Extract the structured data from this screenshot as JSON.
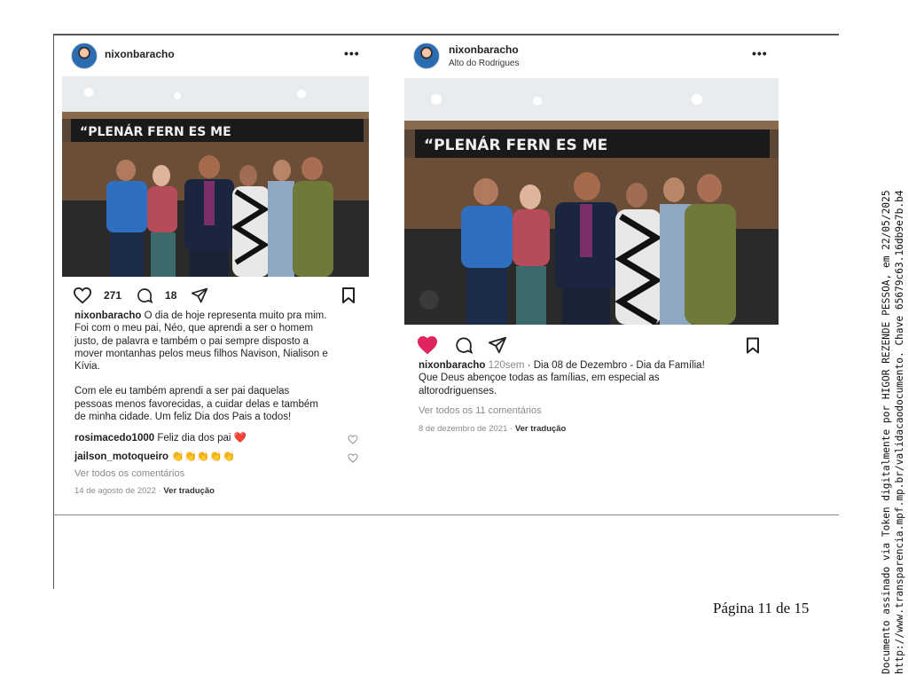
{
  "posts": [
    {
      "username": "nixonbaracho",
      "location": "",
      "more": "•••",
      "likes": "271",
      "comments_count": "18",
      "caption_user": "nixonbaracho",
      "caption_lines": [
        " O dia de hoje representa muito pra mim.",
        "Foi com o meu pai, Néo, que aprendi a ser o homem",
        "justo, de palavra e também o pai sempre disposto a",
        "mover montanhas pelos meus filhos Navison, Nialison e",
        "Kívia.",
        "",
        "Com ele eu também aprendi a ser pai daquelas",
        "pessoas menos favorecidas, a cuidar delas e também",
        "de minha cidade. Um feliz Dia dos Pais a todos!"
      ],
      "comments": [
        {
          "user": "rosimacedo1000",
          "text": " Feliz dia dos pai ❤️"
        },
        {
          "user": "jailson_motoqueiro",
          "text": " 👏👏👏👏👏"
        }
      ],
      "view_all": "Ver todos os comentários",
      "date": "14 de agosto de 2022",
      "translate": "Ver tradução",
      "photo_banner": "“PLENÁRIO ... FERNANDES ... MELO”",
      "liked": false
    },
    {
      "username": "nixonbaracho",
      "location": "Alto do Rodrigues",
      "more": "•••",
      "caption_user": "nixonbaracho",
      "caption_time": " 120sem",
      "caption_lines": [
        " · Dia 08 de Dezembro - Dia da Família!",
        "Que Deus abençoe todas as famílias, em especial as",
        "altorodriguenses."
      ],
      "view_all": "Ver todos os 11 comentários",
      "date": "8 de dezembro de 2021",
      "translate": "Ver tradução",
      "photo_banner": "“PLENÁRIO ... FERNANDES ... MELO”",
      "liked": true
    }
  ],
  "page_number": "Página 11 de 15",
  "side_text": [
    "Documento assinado via Token digitalmente por HIGOR REZENDE PESSOA, em 22/05/2025",
    "http://www.transparencia.mpf.mp.br/validacaodocumento. Chave 65679c63.16db9e7b.b4"
  ],
  "colors": {
    "like_red": "#e0245e",
    "muted": "#8a8a8a",
    "border": "#555555"
  }
}
